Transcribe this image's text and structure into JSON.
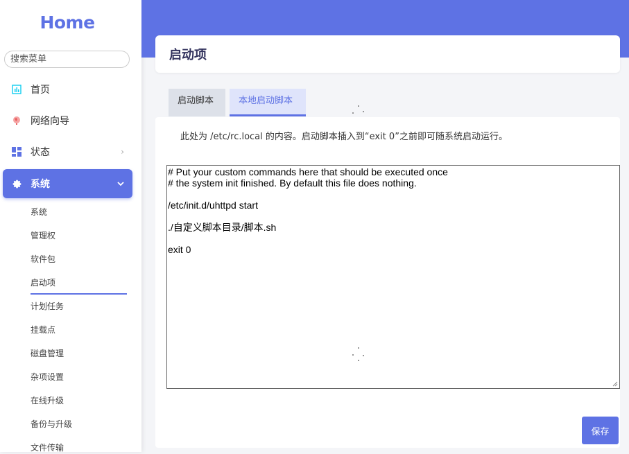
{
  "sidebar": {
    "logo": "Home",
    "search_placeholder": "搜索菜单",
    "menu": [
      {
        "label": "首页",
        "icon": "dashboard-icon"
      },
      {
        "label": "网络向导",
        "icon": "globe-icon"
      },
      {
        "label": "状态",
        "icon": "grid-icon"
      },
      {
        "label": "系统",
        "icon": "gear-icon"
      }
    ],
    "submenu": [
      "系统",
      "管理权",
      "软件包",
      "启动项",
      "计划任务",
      "挂载点",
      "磁盘管理",
      "杂项设置",
      "在线升级",
      "备份与升级",
      "文件传输"
    ],
    "active_submenu": "启动项"
  },
  "page": {
    "title": "启动项",
    "tabs": [
      "启动脚本",
      "本地启动脚本"
    ],
    "active_tab": "本地启动脚本",
    "description": "此处为 /etc/rc.local 的内容。启动脚本插入到“exit 0”之前即可随系统启动运行。",
    "script_content": "# Put your custom commands here that should be executed once\n# the system init finished. By default this file does nothing.\n\n/etc/init.d/uhttpd start\n\n./自定义脚本目录/脚本.sh\n\nexit 0",
    "save_label": "保存"
  },
  "colors": {
    "accent": "#5e72e4",
    "tab_active_bg": "#dfe4fb",
    "tab_inactive_bg": "#dde1e9"
  }
}
